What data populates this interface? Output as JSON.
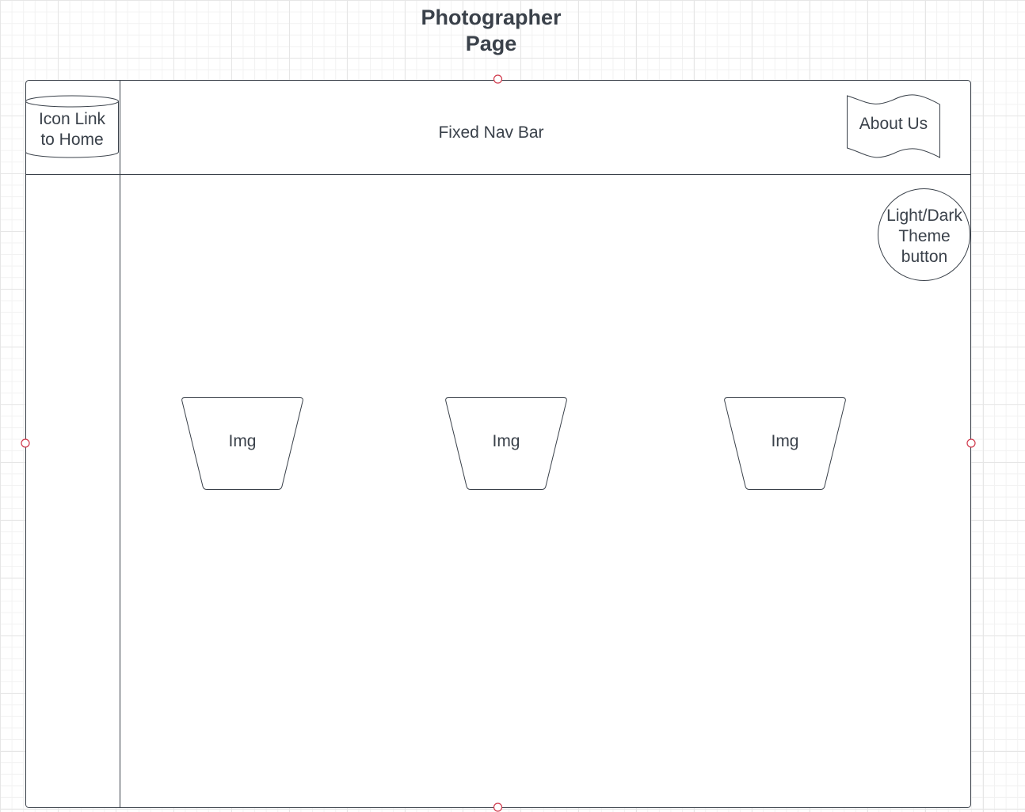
{
  "page": {
    "title": "Photographer\nPage"
  },
  "nav": {
    "home_link_label": "Icon Link to Home",
    "bar_label": "Fixed Nav Bar",
    "about_label": "About Us"
  },
  "theme_button": {
    "label": "Light/Dark Theme button"
  },
  "gallery": {
    "images": [
      {
        "label": "Img"
      },
      {
        "label": "Img"
      },
      {
        "label": "Img"
      }
    ]
  },
  "colors": {
    "stroke": "#3a414a",
    "handle": "#d0384b",
    "grid_major": "#e6e6e6",
    "grid_minor": "#f2f2f2"
  },
  "icons": {
    "home": "cylinder-shape",
    "about": "document-wave-shape",
    "theme": "circle-shape",
    "image": "trapezoid-shape",
    "selection_handle": "circle-handle"
  }
}
